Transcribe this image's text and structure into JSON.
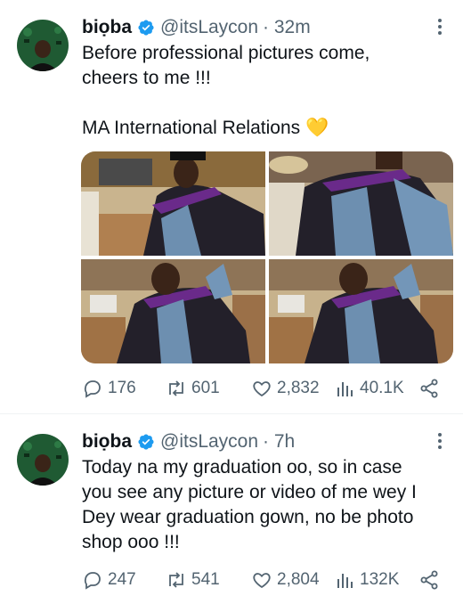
{
  "tweets": [
    {
      "name": "biọba",
      "handle": "@itsLaycon",
      "time": "· 32m",
      "text": "Before professional pictures come,\ncheers to me !!!\n\nMA International Relations 💛",
      "actions": {
        "replies": "176",
        "retweets": "601",
        "likes": "2,832",
        "views": "40.1K"
      }
    },
    {
      "name": "biọba",
      "handle": "@itsLaycon",
      "time": "· 7h",
      "text": "Today na my graduation oo, so in case\nyou see any picture or video of me wey I\nDey wear graduation gown, no be photo\nshop ooo !!!",
      "actions": {
        "replies": "247",
        "retweets": "541",
        "likes": "2,804",
        "views": "132K"
      }
    }
  ],
  "colors": {
    "verified": "#1d9bf0",
    "secondary_text": "#536471",
    "primary_text": "#0f1419"
  },
  "icons": [
    "verified-badge-icon",
    "more-options-icon",
    "reply-icon",
    "retweet-icon",
    "like-icon",
    "views-icon",
    "share-icon"
  ]
}
